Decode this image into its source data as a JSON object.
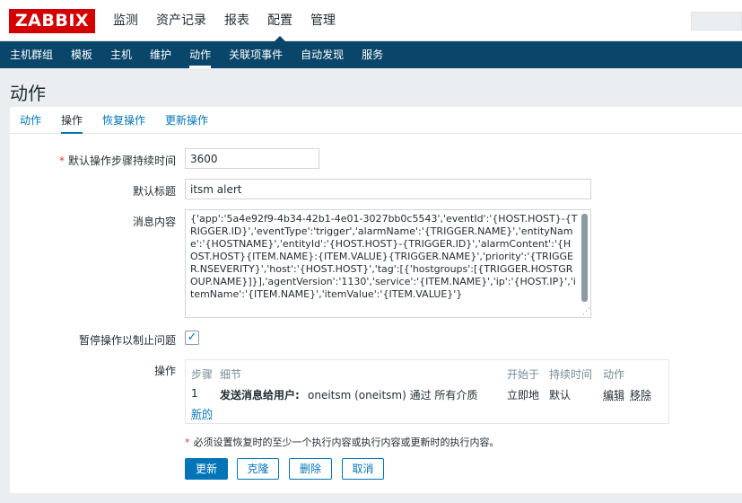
{
  "header": {
    "logo": "ZABBIX",
    "nav": [
      "监测",
      "资产记录",
      "报表",
      "配置",
      "管理"
    ],
    "active_index": 3
  },
  "subnav": {
    "items": [
      "主机群组",
      "模板",
      "主机",
      "维护",
      "动作",
      "关联项事件",
      "自动发现",
      "服务"
    ],
    "active_index": 4
  },
  "page_title": "动作",
  "tabs": {
    "items": [
      "动作",
      "操作",
      "恢复操作",
      "更新操作"
    ],
    "active_index": 1
  },
  "form": {
    "step_duration_label": "默认操作步骤持续时间",
    "step_duration_value": "3600",
    "subject_label": "默认标题",
    "subject_value": "itsm alert",
    "message_label": "消息内容",
    "message_value": "{'app':'5a4e92f9-4b34-42b1-4e01-3027bb0c5543','eventId':'{HOST.HOST}-{TRIGGER.ID}','eventType':'trigger','alarmName':'{TRIGGER.NAME}','entityName':'{HOSTNAME}','entityId':'{HOST.HOST}-{TRIGGER.ID}','alarmContent':'{HOST.HOST}{ITEM.NAME}:{ITEM.VALUE}{TRIGGER.NAME}','priority':'{TRIGGER.NSEVERITY}','host':'{HOST.HOST}','tag':[{'hostgroups':[{TRIGGER.HOSTGROUP.NAME}]}],'agentVersion':'1130','service':'{ITEM.NAME}','ip':'{HOST.IP}','itemName':'{ITEM.NAME}','itemValue':'{ITEM.VALUE}'}",
    "pause_label": "暂停操作以制止问题",
    "pause_checked": true,
    "operations_label": "操作"
  },
  "operations": {
    "headers": [
      "步骤",
      "细节",
      "开始于",
      "持续时间",
      "动作"
    ],
    "rows": [
      {
        "step": "1",
        "detail_bold": "发送消息给用户:",
        "detail_rest": "oneitsm (oneitsm) 通过 所有介质",
        "start": "立即地",
        "duration": "默认",
        "edit": "编辑",
        "remove": "移除"
      }
    ],
    "new_link": "新的"
  },
  "note": "必须设置恢复时的至少一个执行内容或执行内容或更新时的执行内容。",
  "buttons": {
    "update": "更新",
    "clone": "克隆",
    "delete": "删除",
    "cancel": "取消"
  },
  "colors": {
    "brand": "#d40000",
    "subnav": "#0a466a",
    "link": "#0275b8",
    "required": "#e33734"
  }
}
